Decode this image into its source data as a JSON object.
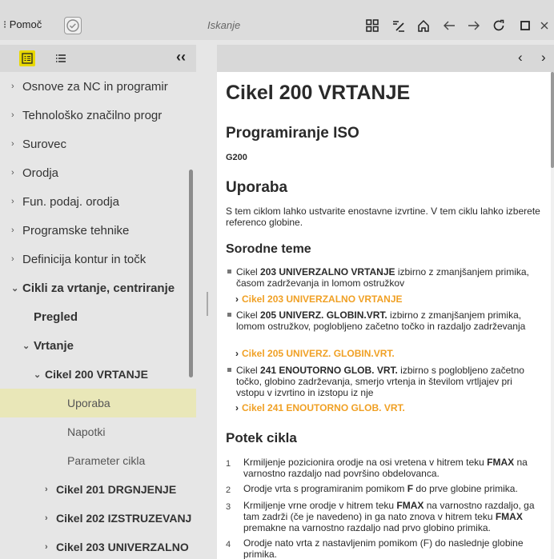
{
  "topbar": {
    "app_title": "⁝ Pomoč",
    "search_placeholder": "Iskanje"
  },
  "sidebar": {
    "collapse_label": "‹‹",
    "items": [
      {
        "label": "Osnove za NC in programir",
        "caret": "›"
      },
      {
        "label": "Tehnološko značilno progr",
        "caret": "›"
      },
      {
        "label": "Surovec",
        "caret": "›"
      },
      {
        "label": "Orodja",
        "caret": "›"
      },
      {
        "label": "Fun. podaj. orodja",
        "caret": "›"
      },
      {
        "label": "Programske tehnike",
        "caret": "›"
      },
      {
        "label": "Definicija kontur in točk",
        "caret": "›"
      },
      {
        "label": "Cikli za vrtanje, centriranje",
        "caret": "⌄"
      },
      {
        "label": "Pregled",
        "caret": ""
      },
      {
        "label": "Vrtanje",
        "caret": "⌄"
      },
      {
        "label": "Cikel 200 VRTANJE",
        "caret": "⌄"
      },
      {
        "label": "Uporaba",
        "caret": ""
      },
      {
        "label": "Napotki",
        "caret": ""
      },
      {
        "label": "Parameter cikla",
        "caret": ""
      },
      {
        "label": "Cikel 201 DRGNJENJE",
        "caret": "›"
      },
      {
        "label": "Cikel 202 IZSTRUZEVANJ",
        "caret": "›"
      },
      {
        "label": "Cikel 203 UNIVERZALNO",
        "caret": "›"
      }
    ]
  },
  "nav": {
    "back": "‹",
    "forward": "›"
  },
  "content": {
    "title": "Cikel 200 VRTANJE",
    "iso_heading": "Programiranje ISO",
    "iso_code": "G200",
    "usage_heading": "Uporaba",
    "usage_text": "S tem ciklom lahko ustvarite enostavne izvrtine. V tem ciklu lahko izberete referenco globine.",
    "related_heading": "Sorodne teme",
    "related": [
      {
        "pre": "Cikel ",
        "bold": "203 UNIVERZALNO VRTANJE",
        "post": " izbirno z zmanjšanjem primika, časom zadrževanja in lomom ostružkov",
        "link": "Cikel 203 UNIVERZALNO VRTANJE"
      },
      {
        "pre": "Cikel ",
        "bold": "205 UNIVERZ. GLOBIN.VRT.",
        "post": " izbirno z zmanjšanjem primika, lomom ostružkov, poglobljeno začetno točko in razdaljo zadrževanja",
        "link": "Cikel 205 UNIVERZ. GLOBIN.VRT."
      },
      {
        "pre": "Cikel ",
        "bold": "241 ENOUTORNO GLOB. VRT.",
        "post": " izbirno s poglobljeno začetno točko, globino zadrževanja, smerjo vrtenja in številom vrtljajev pri vstopu v izvrtino in izstopu iz nje",
        "link": "Cikel 241 ENOUTORNO GLOB. VRT."
      }
    ],
    "flow_heading": "Potek cikla",
    "flow": [
      {
        "num": "1",
        "html_parts": [
          "Krmiljenje pozicionira orodje na osi vretena v hitrem teku ",
          "FMAX",
          " na varnostno razdaljo nad površino obdelovanca."
        ]
      },
      {
        "num": "2",
        "html_parts": [
          "Orodje vrta s programiranim pomikom ",
          "F",
          " do prve globine primika."
        ]
      },
      {
        "num": "3",
        "html_parts": [
          "Krmiljenje vrne orodje v hitrem teku ",
          "FMAX",
          " na varnostno razdaljo, ga tam zadrži (če je navedeno) in ga nato znova v hitrem teku ",
          "FMAX",
          " premakne na varnostno razdaljo nad prvo globino primika."
        ]
      },
      {
        "num": "4",
        "html_parts": [
          "Orodje nato vrta z nastavljenim pomikom (F) do naslednje globine primika."
        ]
      }
    ]
  }
}
